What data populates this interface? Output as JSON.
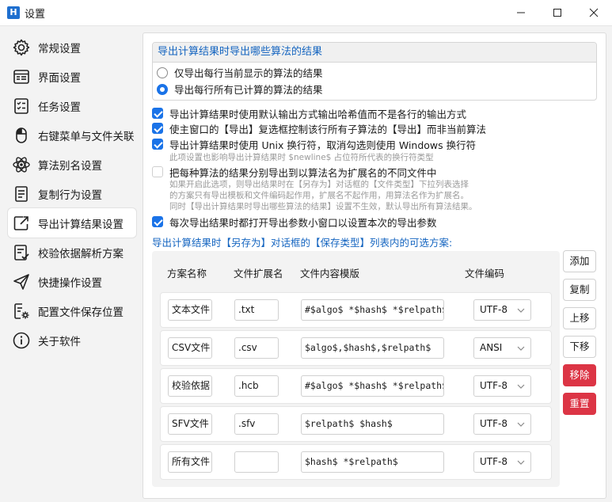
{
  "window": {
    "app_icon_letter": "H",
    "title": "设置"
  },
  "sidebar": {
    "items": [
      {
        "label": "常规设置",
        "icon": "gear-icon",
        "active": false
      },
      {
        "label": "界面设置",
        "icon": "window-icon",
        "active": false
      },
      {
        "label": "任务设置",
        "icon": "checklist-icon",
        "active": false
      },
      {
        "label": "右键菜单与文件关联",
        "icon": "mouse-icon",
        "active": false
      },
      {
        "label": "算法别名设置",
        "icon": "atom-icon",
        "active": false
      },
      {
        "label": "复制行为设置",
        "icon": "copy-document-icon",
        "active": false
      },
      {
        "label": "导出计算结果设置",
        "icon": "export-icon",
        "active": true
      },
      {
        "label": "校验依据解析方案",
        "icon": "verify-document-icon",
        "active": false
      },
      {
        "label": "快捷操作设置",
        "icon": "send-icon",
        "active": false
      },
      {
        "label": "配置文件保存位置",
        "icon": "config-file-icon",
        "active": false
      },
      {
        "label": "关于软件",
        "icon": "info-icon",
        "active": false
      }
    ]
  },
  "export_scope": {
    "heading": "导出计算结果时导出哪些算法的结果",
    "options": [
      {
        "label": "仅导出每行当前显示的算法的结果",
        "selected": false
      },
      {
        "label": "导出每行所有已计算的算法的结果",
        "selected": true
      }
    ]
  },
  "options": {
    "default_format": {
      "label": "导出计算结果时使用默认输出方式输出哈希值而不是各行的输出方式",
      "checked": true
    },
    "main_checkbox": {
      "label": "使主窗口的【导出】复选框控制该行所有子算法的【导出】而非当前算法",
      "checked": true
    },
    "unix_newline": {
      "label": "导出计算结果时使用 Unix 换行符，取消勾选则使用 Windows 换行符",
      "checked": true,
      "hint": "此项设置也影响导出计算结果时 $newline$ 占位符所代表的换行符类型"
    },
    "separate_files": {
      "label": "把每种算法的结果分别导出到以算法名为扩展名的不同文件中",
      "checked": false,
      "hint_lines": [
        "如果开启此选项，则导出结果时在【另存为】对话框的【文件类型】下拉列表选择",
        "的方案只有导出模板和文件编码起作用，扩展名不起作用，用算法名作为扩展名。",
        "同时【导出计算结果时导出哪些算法的结果】设置不生效，默认导出所有算法结果。"
      ]
    },
    "ask_each_time": {
      "label": "每次导出结果时都打开导出参数小窗口以设置本次的导出参数",
      "checked": true
    }
  },
  "schemes": {
    "section_title": "导出计算结果时【另存为】对话框的【保存类型】列表内的可选方案:",
    "columns": [
      "方案名称",
      "文件扩展名",
      "文件内容模版",
      "文件编码"
    ],
    "rows": [
      {
        "name": "文本文件",
        "ext": ".txt",
        "template": "#$algo$ *$hash$ *$relpath$",
        "encoding": "UTF-8"
      },
      {
        "name": "CSV文件",
        "ext": ".csv",
        "template": "$algo$,$hash$,$relpath$",
        "encoding": "ANSI"
      },
      {
        "name": "校验依据",
        "ext": ".hcb",
        "template": "#$algo$ *$hash$ *$relpath$",
        "encoding": "UTF-8"
      },
      {
        "name": "SFV文件",
        "ext": ".sfv",
        "template": "$relpath$ $hash$",
        "encoding": "UTF-8"
      },
      {
        "name": "所有文件",
        "ext": "",
        "template": "$hash$ *$relpath$",
        "encoding": "UTF-8"
      }
    ]
  },
  "actions": {
    "add": "添加",
    "copy": "复制",
    "up": "上移",
    "down": "下移",
    "remove": "移除",
    "reset": "重置"
  },
  "colors": {
    "accent": "#1a73e8",
    "heading_blue": "#1565c0",
    "danger": "#dc3545"
  }
}
